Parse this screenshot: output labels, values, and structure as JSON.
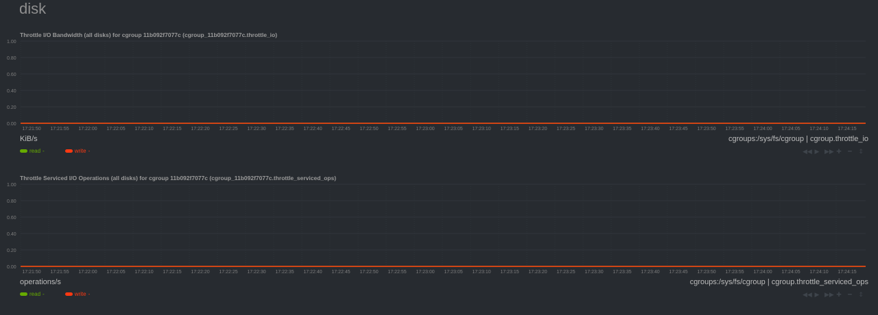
{
  "section": {
    "title": "disk"
  },
  "charts": [
    {
      "title": "Throttle I/O Bandwidth (all disks) for cgroup 11b092f7077c (cgroup_11b092f7077c.throttle_io)",
      "units": "KiB/s",
      "source": "cgroups:/sys/fs/cgroup | cgroup.throttle_io",
      "legend": [
        {
          "name": "read",
          "value": "-",
          "color": "#66aa00"
        },
        {
          "name": "write",
          "value": "-",
          "color": "#fe3912"
        }
      ]
    },
    {
      "title": "Throttle Serviced I/O Operations (all disks) for cgroup 11b092f7077c (cgroup_11b092f7077c.throttle_serviced_ops)",
      "units": "operations/s",
      "source": "cgroups:/sys/fs/cgroup | cgroup.throttle_serviced_ops",
      "legend": [
        {
          "name": "read",
          "value": "-",
          "color": "#66aa00"
        },
        {
          "name": "write",
          "value": "-",
          "color": "#fe3912"
        }
      ]
    }
  ],
  "toolbox_icons": [
    "backward-icon",
    "play-icon",
    "forward-icon",
    "zoom-in-icon",
    "zoom-out-icon",
    "resize-icon"
  ],
  "chart_data": [
    {
      "type": "line",
      "title": "Throttle I/O Bandwidth (all disks) for cgroup 11b092f7077c (cgroup_11b092f7077c.throttle_io)",
      "xlabel": "",
      "ylabel": "KiB/s",
      "ylim": [
        0,
        1
      ],
      "yticks": [
        "1.00",
        "0.80",
        "0.60",
        "0.40",
        "0.20",
        "0.00"
      ],
      "x": [
        "17:21:50",
        "17:21:55",
        "17:22:00",
        "17:22:05",
        "17:22:10",
        "17:22:15",
        "17:22:20",
        "17:22:25",
        "17:22:30",
        "17:22:35",
        "17:22:40",
        "17:22:45",
        "17:22:50",
        "17:22:55",
        "17:23:00",
        "17:23:05",
        "17:23:10",
        "17:23:15",
        "17:23:20",
        "17:23:25",
        "17:23:30",
        "17:23:35",
        "17:23:40",
        "17:23:45",
        "17:23:50",
        "17:23:55",
        "17:24:00",
        "17:24:05",
        "17:24:10",
        "17:24:15"
      ],
      "series": [
        {
          "name": "read",
          "color": "#66aa00",
          "values": [
            0,
            0,
            0,
            0,
            0,
            0,
            0,
            0,
            0,
            0,
            0,
            0,
            0,
            0,
            0,
            0,
            0,
            0,
            0,
            0,
            0,
            0,
            0,
            0,
            0,
            0,
            0,
            0,
            0,
            0
          ]
        },
        {
          "name": "write",
          "color": "#fe3912",
          "values": [
            0,
            0,
            0,
            0,
            0,
            0,
            0,
            0,
            0,
            0,
            0,
            0,
            0,
            0,
            0,
            0,
            0,
            0,
            0,
            0,
            0,
            0,
            0,
            0,
            0,
            0,
            0,
            0,
            0,
            0
          ]
        }
      ],
      "grid": true,
      "legend": "bottom-left"
    },
    {
      "type": "line",
      "title": "Throttle Serviced I/O Operations (all disks) for cgroup 11b092f7077c (cgroup_11b092f7077c.throttle_serviced_ops)",
      "xlabel": "",
      "ylabel": "operations/s",
      "ylim": [
        0,
        1
      ],
      "yticks": [
        "1.00",
        "0.80",
        "0.60",
        "0.40",
        "0.20",
        "0.00"
      ],
      "x": [
        "17:21:50",
        "17:21:55",
        "17:22:00",
        "17:22:05",
        "17:22:10",
        "17:22:15",
        "17:22:20",
        "17:22:25",
        "17:22:30",
        "17:22:35",
        "17:22:40",
        "17:22:45",
        "17:22:50",
        "17:22:55",
        "17:23:00",
        "17:23:05",
        "17:23:10",
        "17:23:15",
        "17:23:20",
        "17:23:25",
        "17:23:30",
        "17:23:35",
        "17:23:40",
        "17:23:45",
        "17:23:50",
        "17:23:55",
        "17:24:00",
        "17:24:05",
        "17:24:10",
        "17:24:15"
      ],
      "series": [
        {
          "name": "read",
          "color": "#66aa00",
          "values": [
            0,
            0,
            0,
            0,
            0,
            0,
            0,
            0,
            0,
            0,
            0,
            0,
            0,
            0,
            0,
            0,
            0,
            0,
            0,
            0,
            0,
            0,
            0,
            0,
            0,
            0,
            0,
            0,
            0,
            0
          ]
        },
        {
          "name": "write",
          "color": "#fe3912",
          "values": [
            0,
            0,
            0,
            0,
            0,
            0,
            0,
            0,
            0,
            0,
            0,
            0,
            0,
            0,
            0,
            0,
            0,
            0,
            0,
            0,
            0,
            0,
            0,
            0,
            0,
            0,
            0,
            0,
            0,
            0
          ]
        }
      ],
      "grid": true,
      "legend": "bottom-left"
    }
  ]
}
